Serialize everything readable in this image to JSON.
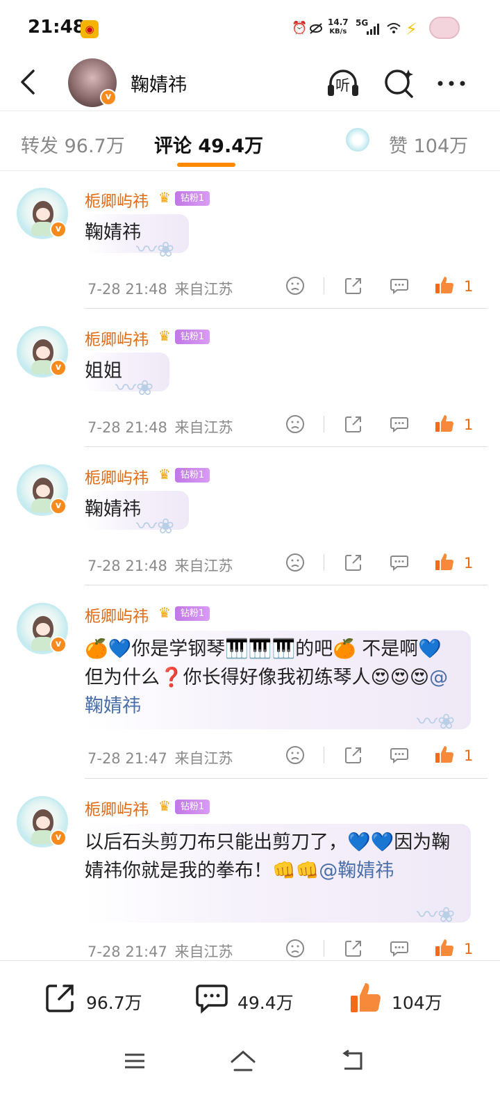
{
  "status_bar": {
    "time": "21:48",
    "net_speed_value": "14.7",
    "net_speed_unit": "KB/s",
    "network": "5G",
    "icons": [
      "weibo-icon",
      "alarm-icon",
      "eye-off-icon",
      "signal-icon",
      "wifi-icon",
      "charging-icon",
      "battery-icon"
    ]
  },
  "header": {
    "name": "鞠婧祎",
    "verified_mark": "v",
    "listen_label": "听"
  },
  "tabs": {
    "repost": "转发 96.7万",
    "comment": "评论 49.4万",
    "like": "赞 104万"
  },
  "accent_color": "#ff8a00",
  "comments": [
    {
      "user": "栀卿屿祎",
      "fan_level": "5",
      "fan_badge": "钻粉1",
      "content": "鞠婧祎",
      "date": "7-28 21:48",
      "location": "来自江苏",
      "likes": "1"
    },
    {
      "user": "栀卿屿祎",
      "fan_level": "5",
      "fan_badge": "钻粉1",
      "content": "姐姐",
      "date": "7-28 21:48",
      "location": "来自江苏",
      "likes": "1"
    },
    {
      "user": "栀卿屿祎",
      "fan_level": "5",
      "fan_badge": "钻粉1",
      "content": "鞠婧祎",
      "date": "7-28 21:48",
      "location": "来自江苏",
      "likes": "1"
    },
    {
      "user": "栀卿屿祎",
      "fan_level": "5",
      "fan_badge": "钻粉1",
      "content": "🍊💙你是学钢琴🎹🎹🎹的吧🍊 不是啊💙 但为什么❓你长得好像我初练琴人😍😍😍",
      "mention": "@鞠婧祎",
      "date": "7-28 21:47",
      "location": "来自江苏",
      "likes": "1"
    },
    {
      "user": "栀卿屿祎",
      "fan_level": "5",
      "fan_badge": "钻粉1",
      "content": "以后石头剪刀布只能出剪刀了，💙💙因为鞠婧祎你就是我的拳布！👊👊",
      "mention": "@鞠婧祎",
      "date": "7-28 21:47",
      "location": "来自江苏",
      "likes": "1"
    }
  ],
  "bottom_bar": {
    "reposts": "96.7万",
    "comments": "49.4万",
    "likes": "104万"
  }
}
